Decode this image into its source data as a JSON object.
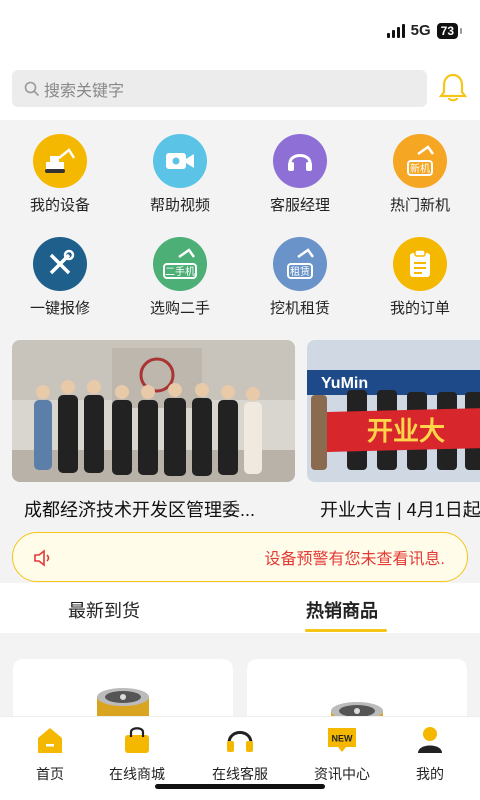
{
  "status_bar": {
    "network": "5G",
    "battery": "73"
  },
  "search": {
    "placeholder": "搜索关键字"
  },
  "grid": [
    {
      "label": "我的设备",
      "icon": "excavator-icon",
      "color": "#f5b800"
    },
    {
      "label": "帮助视频",
      "icon": "video-camera-icon",
      "color": "#5bc4e6"
    },
    {
      "label": "客服经理",
      "icon": "headset-icon",
      "color": "#8e6fd6"
    },
    {
      "label": "热门新机",
      "icon": "new-excavator-icon",
      "color": "#f5a623",
      "tag": "新机"
    },
    {
      "label": "一键报修",
      "icon": "wrench-screwdriver-icon",
      "color": "#1e5f8c"
    },
    {
      "label": "选购二手",
      "icon": "used-excavator-icon",
      "color": "#4caf75",
      "tag": "二手机"
    },
    {
      "label": "挖机租赁",
      "icon": "rental-excavator-icon",
      "color": "#6a93c9",
      "tag": "租赁"
    },
    {
      "label": "我的订单",
      "icon": "clipboard-icon",
      "color": "#f5b800"
    }
  ],
  "banners": [
    {
      "title": "成都经济技术开发区管理委..."
    },
    {
      "title": "开业大吉 | 4月1日起",
      "sign_text": "开业大",
      "logo_text": "YuMin"
    }
  ],
  "notice": {
    "text": "设备预警有您未查看讯息."
  },
  "tabs": [
    {
      "label": "最新到货",
      "active": false
    },
    {
      "label": "热销商品",
      "active": true
    }
  ],
  "nav": [
    {
      "label": "首页",
      "icon": "home-icon"
    },
    {
      "label": "在线商城",
      "icon": "shopping-bag-icon"
    },
    {
      "label": "在线客服",
      "icon": "headphones-icon"
    },
    {
      "label": "资讯中心",
      "icon": "news-icon",
      "badge": "NEW"
    },
    {
      "label": "我的",
      "icon": "user-icon"
    }
  ],
  "colors": {
    "accent": "#f5c518",
    "alert": "#e53935"
  }
}
